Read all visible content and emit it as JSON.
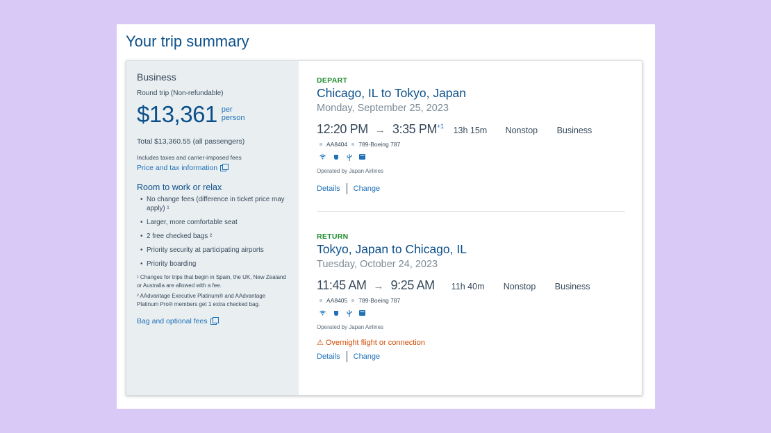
{
  "page": {
    "title": "Your trip summary"
  },
  "summary": {
    "cabin": "Business",
    "trip_type": "Round trip (Non-refundable)",
    "price": "$13,361",
    "per_line1": "per",
    "per_line2": "person",
    "total": "Total $13,360.55 (all passengers)",
    "fees_note": "Includes taxes and carrier-imposed fees",
    "price_tax_link": "Price and tax information",
    "benefits_title": "Room to work or relax",
    "benefits": [
      "No change fees (difference in ticket price may apply) ¹",
      "Larger, more comfortable seat",
      "2 free checked bags ²",
      "Priority security at participating airports",
      "Priority boarding"
    ],
    "footnote1": "¹ Changes for trips that begin in Spain, the UK, New Zealand or Australia are allowed with a fee.",
    "footnote2": "² AAdvantage Executive Platinum® and AAdvantage Platinum Pro® members get 1 extra checked bag.",
    "bag_link": "Bag and optional fees"
  },
  "depart": {
    "label": "DEPART",
    "route": "Chicago, IL to Tokyo, Japan",
    "date": "Monday, September 25, 2023",
    "dep_time": "12:20 PM",
    "arr_time": "3:35 PM",
    "day_offset": "+1",
    "duration": "13h 15m",
    "stops": "Nonstop",
    "cabin": "Business",
    "flight_no": "AA8404",
    "aircraft": "789-Boeing 787",
    "operated": "Operated by Japan Airlines",
    "details": "Details",
    "change": "Change"
  },
  "return": {
    "label": "RETURN",
    "route": "Tokyo, Japan to Chicago, IL",
    "date": "Tuesday, October 24, 2023",
    "dep_time": "11:45 AM",
    "arr_time": "9:25 AM",
    "duration": "11h 40m",
    "stops": "Nonstop",
    "cabin": "Business",
    "flight_no": "AA8405",
    "aircraft": "789-Boeing 787",
    "operated": "Operated by Japan Airlines",
    "warning": "Overnight flight or connection",
    "details": "Details",
    "change": "Change"
  },
  "icons": {
    "wifi": "wifi-icon",
    "power": "power-icon",
    "usb": "usb-icon",
    "entertainment": "entertainment-icon",
    "warning": "warning-icon",
    "external": "external-link-icon"
  },
  "colors": {
    "accent": "#0b4f8a",
    "link": "#1f71b8",
    "depart_green": "#1f8c2e",
    "warning": "#d14900",
    "background": "#d9c9f7"
  }
}
